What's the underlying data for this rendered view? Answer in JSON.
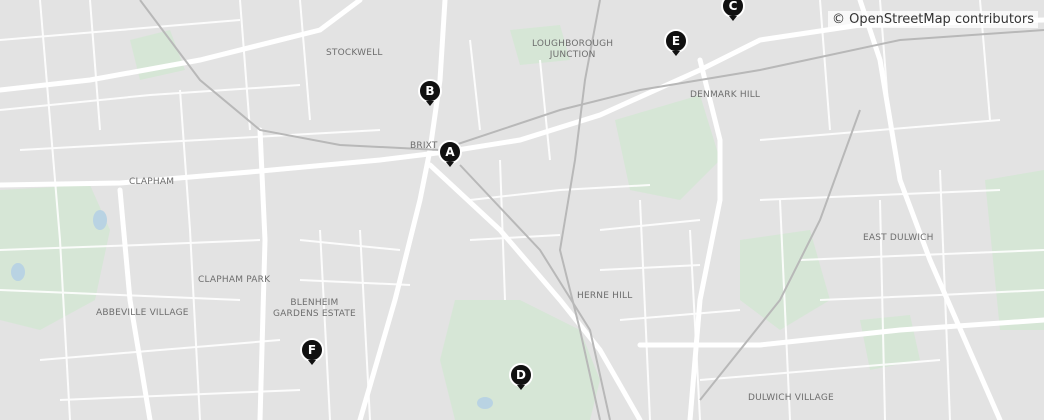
{
  "map": {
    "attribution": "© OpenStreetMap contributors",
    "colors": {
      "land": "#e3e3e3",
      "park": "#d6e6d6",
      "road": "#ffffff",
      "rail": "#b8b8b8",
      "marker": "#111111",
      "label": "#6e6e6e"
    },
    "places": [
      {
        "id": "stockwell",
        "name": "STOCKWELL"
      },
      {
        "id": "loughborough",
        "name": "LOUGHBOROUGH\nJUNCTION"
      },
      {
        "id": "denmark-hill",
        "name": "DENMARK HILL"
      },
      {
        "id": "brixton",
        "name": "BRIXT"
      },
      {
        "id": "clapham",
        "name": "CLAPHAM"
      },
      {
        "id": "east-dulwich",
        "name": "EAST DULWICH"
      },
      {
        "id": "clapham-park",
        "name": "CLAPHAM PARK"
      },
      {
        "id": "herne-hill",
        "name": "HERNE HILL"
      },
      {
        "id": "blenheim",
        "name": "BLENHEIM\nGARDENS ESTATE"
      },
      {
        "id": "abbeville",
        "name": "ABBEVILLE VILLAGE"
      },
      {
        "id": "dulwich-village",
        "name": "DULWICH VILLAGE"
      }
    ],
    "markers": [
      {
        "label": "A"
      },
      {
        "label": "B"
      },
      {
        "label": "C"
      },
      {
        "label": "D"
      },
      {
        "label": "E"
      },
      {
        "label": "F"
      }
    ]
  }
}
